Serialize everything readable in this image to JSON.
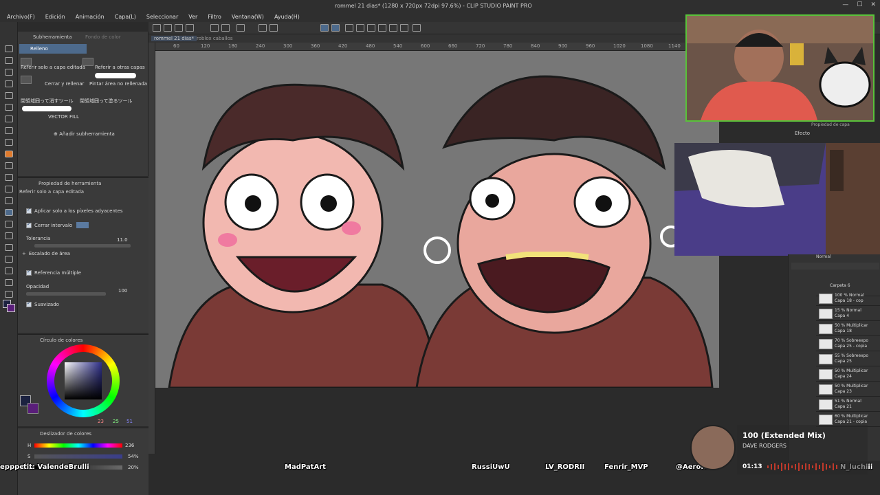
{
  "window": {
    "title": "rommel 21 dias* (1280 x 720px 72dpi 97.6%) - CLIP STUDIO PAINT PRO",
    "controls": [
      "—",
      "☐",
      "✕"
    ]
  },
  "menu": [
    "Archivo(F)",
    "Edición",
    "Animación",
    "Capa(L)",
    "Seleccionar",
    "Ver",
    "Filtro",
    "Ventana(W)",
    "Ayuda(H)"
  ],
  "canvas": {
    "tabs": [
      "rommel 21 dias*",
      "roblox caballos"
    ],
    "ruler_ticks": [
      "60",
      "120",
      "180",
      "240",
      "300",
      "360",
      "420",
      "480",
      "540",
      "600",
      "660",
      "720",
      "780",
      "840",
      "900",
      "960",
      "1020",
      "1080",
      "1140"
    ]
  },
  "subtool": {
    "tab_label": "Subherramienta",
    "tab_label2": "Fondo de color",
    "selected": "Relleno",
    "items": [
      "Referir solo a capa editada",
      "Referir a otras capas",
      "Cerrar y rellenar",
      "Pintar área no rellenada",
      "閉領域囲って消すツール",
      "閉領域囲って塗るツール",
      "VECTOR FILL"
    ],
    "add_label": "Añadir subherramienta"
  },
  "toolprop": {
    "header": "Propiedad de herramienta",
    "preset": "Referir solo a capa editada",
    "options": {
      "adjacent": "Aplicar solo a los píxeles adyacentes",
      "close_gap": "Cerrar intervalo",
      "tolerance_label": "Tolerancia",
      "tolerance_value": "11.0",
      "area_scale": "Escalado de área",
      "multi_ref": "Referencia múltiple",
      "opacity_label": "Opacidad",
      "opacity_value": "100",
      "smooth": "Suavizado"
    }
  },
  "colorcircle": {
    "header": "Círculo de colores",
    "r": "23",
    "g": "25",
    "b": "51"
  },
  "colorslider": {
    "header": "Deslizador de colores",
    "h_label": "H",
    "h_value": "236",
    "s_label": "S",
    "s_value": "54%",
    "v_label": "V",
    "v_value": "20%"
  },
  "layers": [
    {
      "pct": "",
      "blend": "Carpeta 6",
      "name": ""
    },
    {
      "pct": "100 %",
      "blend": "Normal",
      "name": "Capa 18 - cop"
    },
    {
      "pct": "15 %",
      "blend": "Normal",
      "name": "Capa 4"
    },
    {
      "pct": "50 %",
      "blend": "Multiplicar",
      "name": "Capa 18"
    },
    {
      "pct": "70 %",
      "blend": "Sobreexpo",
      "name": "Capa 25 - copia"
    },
    {
      "pct": "55 %",
      "blend": "Sobreexpo",
      "name": "Capa 25"
    },
    {
      "pct": "50 %",
      "blend": "Multiplicar",
      "name": "Capa 24"
    },
    {
      "pct": "50 %",
      "blend": "Multiplicar",
      "name": "Capa 23"
    },
    {
      "pct": "51 %",
      "blend": "Normal",
      "name": "Capa 21"
    },
    {
      "pct": "60 %",
      "blend": "Multiplicar",
      "name": "Capa 21 - copia"
    }
  ],
  "props_panel": {
    "title": "Propiedad de capa",
    "effect": "Efecto",
    "blend_mode": "Normal"
  },
  "chat": [
    "epppelin",
    "tit: ValendeBrulli",
    "MadPatArt",
    "RussiUwU",
    "LV_RODRII",
    "Fenrir_MVP",
    "@AeroKick",
    "N_luchiii"
  ],
  "music": {
    "title": "100 (Extended Mix)",
    "artist": "DAVE RODGERS",
    "time": "01:13"
  },
  "colors": {
    "accent": "#4d6a8c",
    "webcam_border": "#59c23a",
    "panel": "#3a3a3a"
  }
}
